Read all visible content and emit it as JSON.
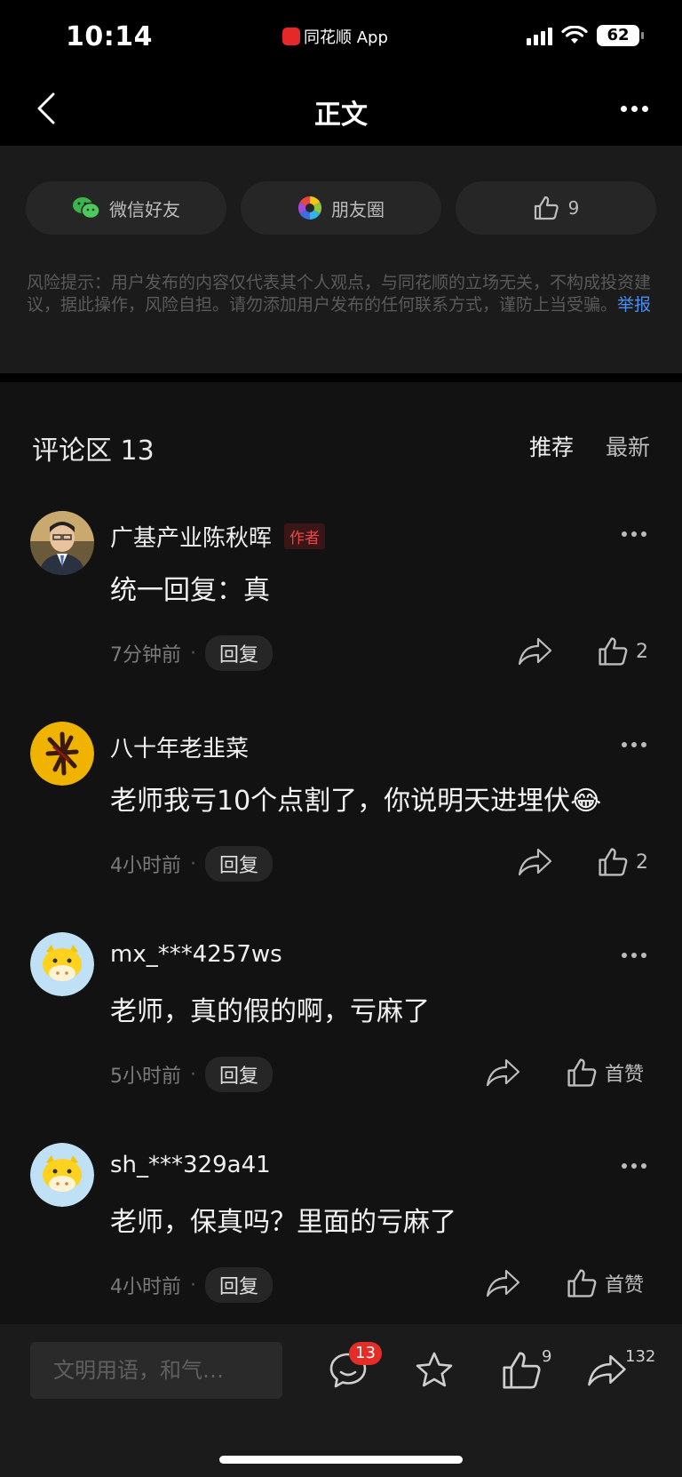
{
  "status_bar": {
    "time": "10:14",
    "app_name": "同花顺 App",
    "battery": "62"
  },
  "nav": {
    "title": "正文"
  },
  "share": {
    "wechat_label": "微信好友",
    "moments_label": "朋友圈",
    "like_count": "9"
  },
  "risk": {
    "text": "风险提示：用户发布的内容仅代表其个人观点，与同花顺的立场无关，不构成投资建议，据此操作，风险自担。请勿添加用户发布的任何联系方式，谨防上当受骗。",
    "report_label": "举报"
  },
  "comments_section": {
    "title": "评论区 13",
    "sort_recommend": "推荐",
    "sort_latest": "最新",
    "items": [
      {
        "user": "广基产业陈秋晖",
        "tag": "作者",
        "text": "统一回复：真",
        "time": "7分钟前",
        "reply_label": "回复",
        "likes": "2",
        "emoji": ""
      },
      {
        "user": "八十年老韭菜",
        "tag": "",
        "text": "老师我亏10个点割了，你说明天进埋伏",
        "time": "4小时前",
        "reply_label": "回复",
        "likes": "2",
        "emoji": "😂"
      },
      {
        "user": "mx_***4257ws",
        "tag": "",
        "text": "老师，真的假的啊，亏麻了",
        "time": "5小时前",
        "reply_label": "回复",
        "likes": "首赞",
        "emoji": ""
      },
      {
        "user": "sh_***329a41",
        "tag": "",
        "text": "老师，保真吗？里面的亏麻了",
        "time": "4小时前",
        "reply_label": "回复",
        "likes": "首赞",
        "emoji": ""
      }
    ]
  },
  "bottom_bar": {
    "input_placeholder": "文明用语，和气…",
    "comment_badge": "13",
    "like_count": "9",
    "share_count": "132"
  },
  "colors": {
    "background": "#121212",
    "accent_link": "#4a8ef0",
    "badge": "#e52d27",
    "author_tag": "#e5484d"
  }
}
